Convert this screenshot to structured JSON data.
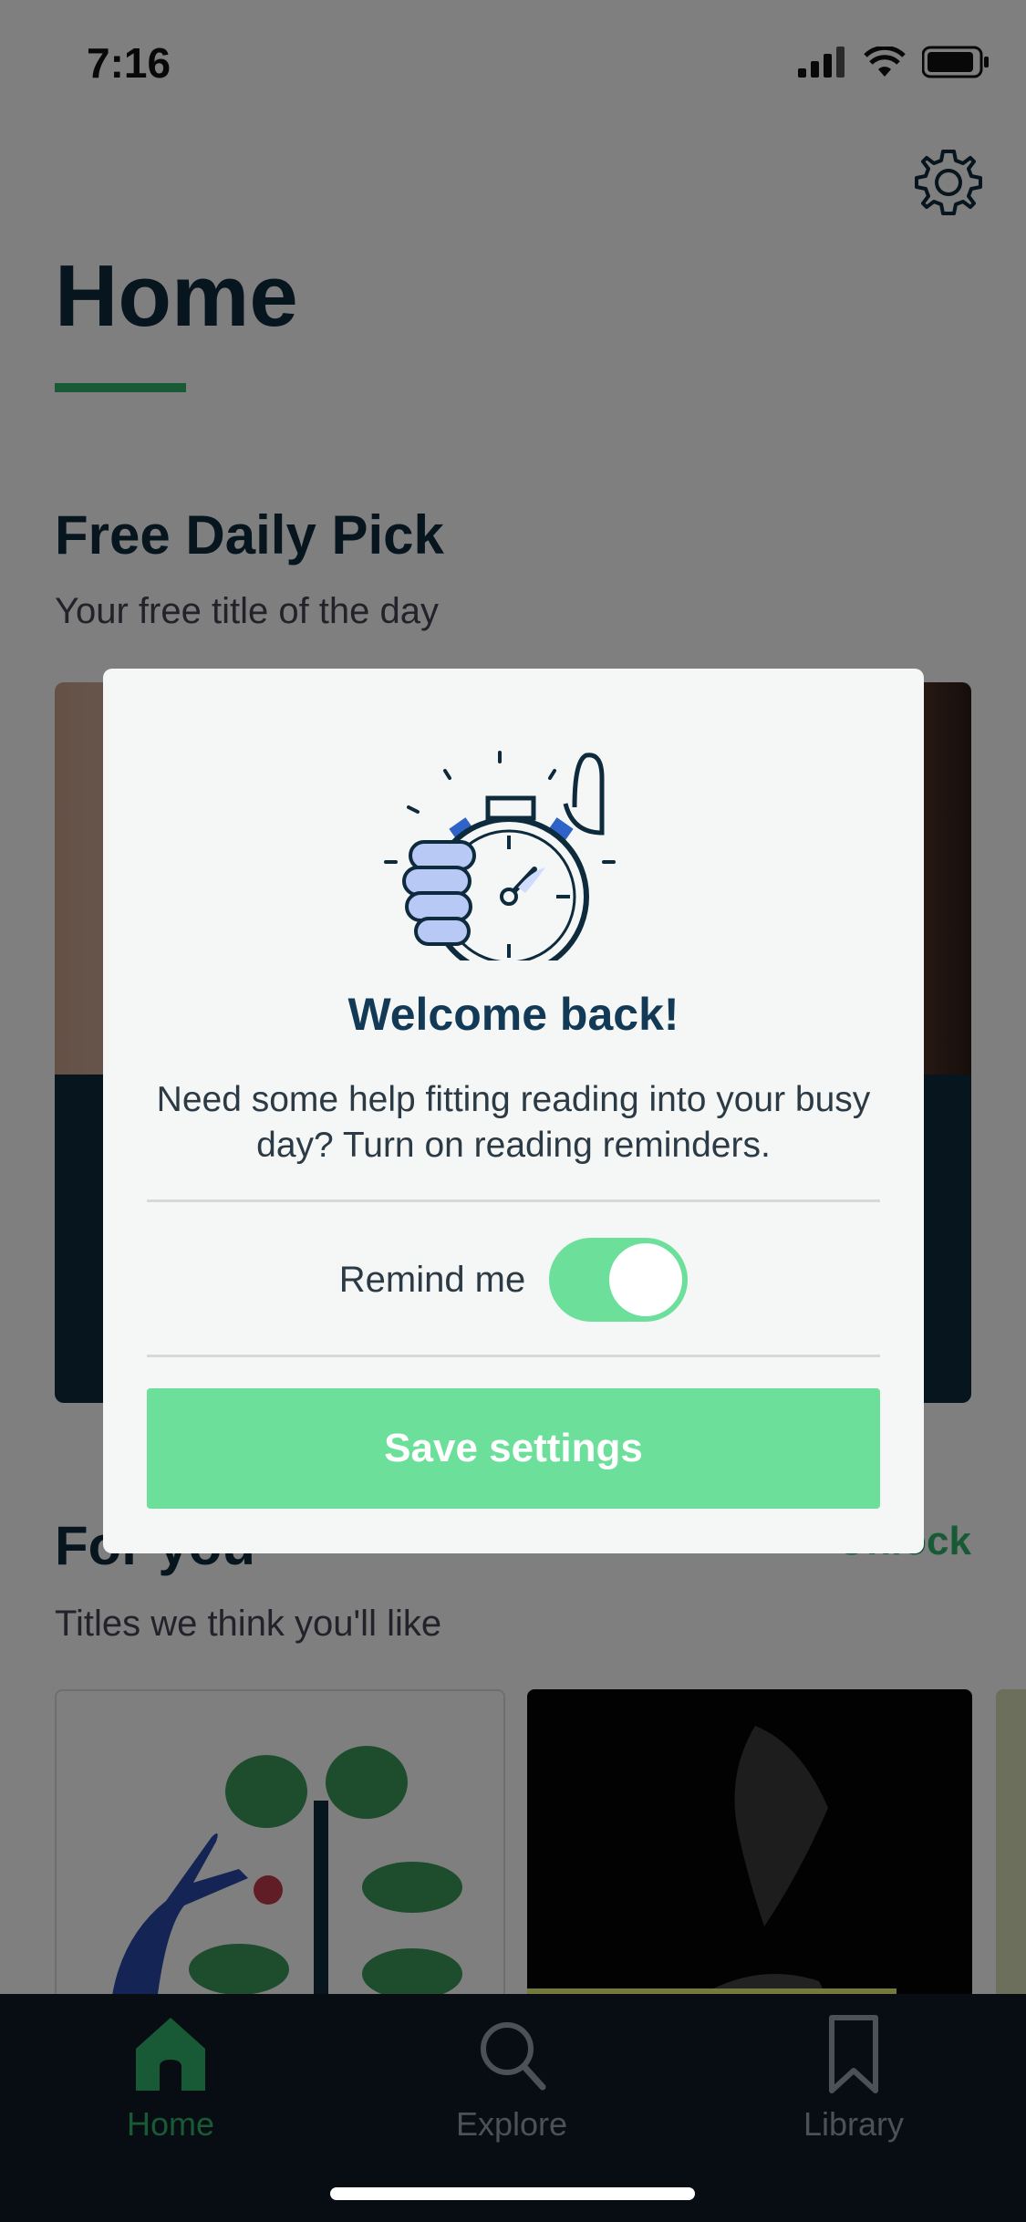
{
  "status": {
    "time": "7:16"
  },
  "page": {
    "title": "Home"
  },
  "daily": {
    "title": "Free Daily Pick",
    "subtitle": "Your free title of the day"
  },
  "for_you": {
    "title": "For you",
    "subtitle": "Titles we think you'll like",
    "action": "Unlock"
  },
  "tabs": [
    {
      "label": "Home",
      "icon": "home-icon",
      "active": true
    },
    {
      "label": "Explore",
      "icon": "search-icon",
      "active": false
    },
    {
      "label": "Library",
      "icon": "bookmark-icon",
      "active": false
    }
  ],
  "modal": {
    "title": "Welcome back!",
    "body": "Need some help fitting reading into your busy day? Turn on reading reminders.",
    "remind_label": "Remind me",
    "remind_on": true,
    "save_label": "Save settings",
    "illustration": "stopwatch-hand-icon"
  },
  "colors": {
    "accent": "#2fb46a",
    "toggle": "#6ce09a",
    "navy": "#0e2a3d"
  }
}
